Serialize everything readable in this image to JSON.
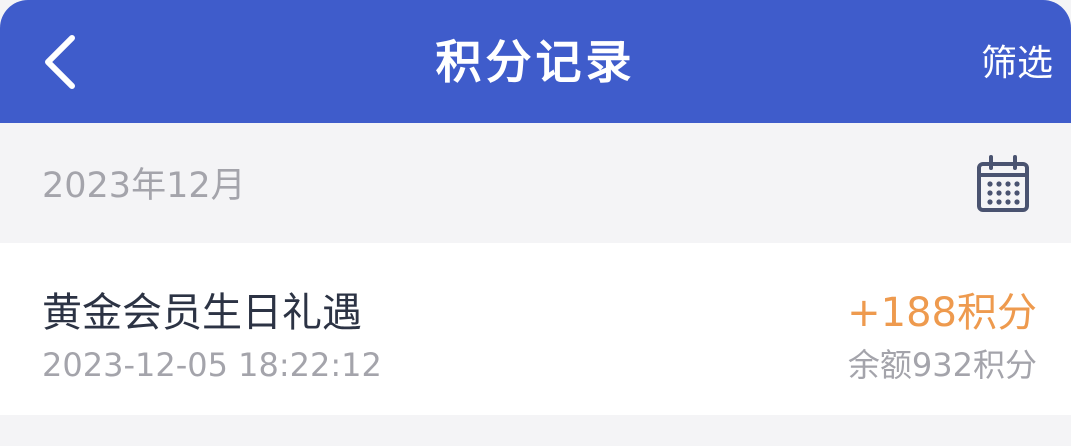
{
  "header": {
    "title": "积分记录",
    "filter_label": "筛选",
    "back_icon": "chevron-left-icon",
    "background_color": "#3f5ccb"
  },
  "month_bar": {
    "label": "2023年12月",
    "calendar_icon": "calendar-icon"
  },
  "records": [
    {
      "title": "黄金会员生日礼遇",
      "time": "2023-12-05 18:22:12",
      "points": "+188积分",
      "balance": "余额932积分",
      "points_color": "#ee9a4e"
    }
  ]
}
